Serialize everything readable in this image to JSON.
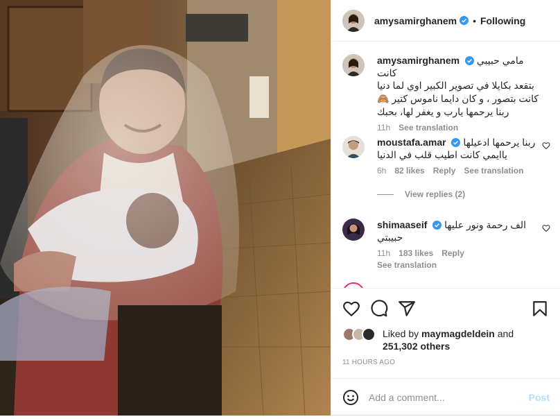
{
  "header": {
    "username": "amysamirghanem",
    "separator": "•",
    "follow_status": "Following"
  },
  "comments": [
    {
      "username": "amysamirghanem",
      "lines": [
        "مامي حبيبي كانت",
        "بتقعد بكايلا في تصوير الكبير اوي لما دنيا",
        "كانت بتصور ، و كان دايما ناموس كتير 🙈",
        "ربنا يرحمها يارب و يغفر لها، بحبك"
      ],
      "time": "11h",
      "translate": "See translation"
    },
    {
      "username": "moustafa.amar",
      "lines": [
        "ربنا يرحمها ادعيلها",
        "ياايمي كانت اطيب قلب في الدنيا"
      ],
      "time": "6h",
      "likes": "82 likes",
      "reply": "Reply",
      "translate": "See translation",
      "view_replies": "View replies (2)"
    },
    {
      "username": "shimaaseif",
      "lines": [
        "الف رحمة ونور عليها",
        "حبيبتي"
      ],
      "time": "11h",
      "likes": "183 likes",
      "reply": "Reply",
      "translate": "See translation"
    }
  ],
  "likes": {
    "prefix": "Liked by",
    "liker": "maymagdeldein",
    "conj": "and",
    "others": "251,302 others"
  },
  "timestamp": "11 HOURS AGO",
  "add_comment": {
    "placeholder": "Add a comment...",
    "post": "Post"
  },
  "colors": {
    "verified": "#3897f0",
    "muted": "#8e8e8e",
    "post_disabled": "#b2dffc"
  },
  "icons": [
    "emoji-icon",
    "heart-icon",
    "comment-icon",
    "share-icon",
    "bookmark-icon",
    "verified-icon"
  ]
}
